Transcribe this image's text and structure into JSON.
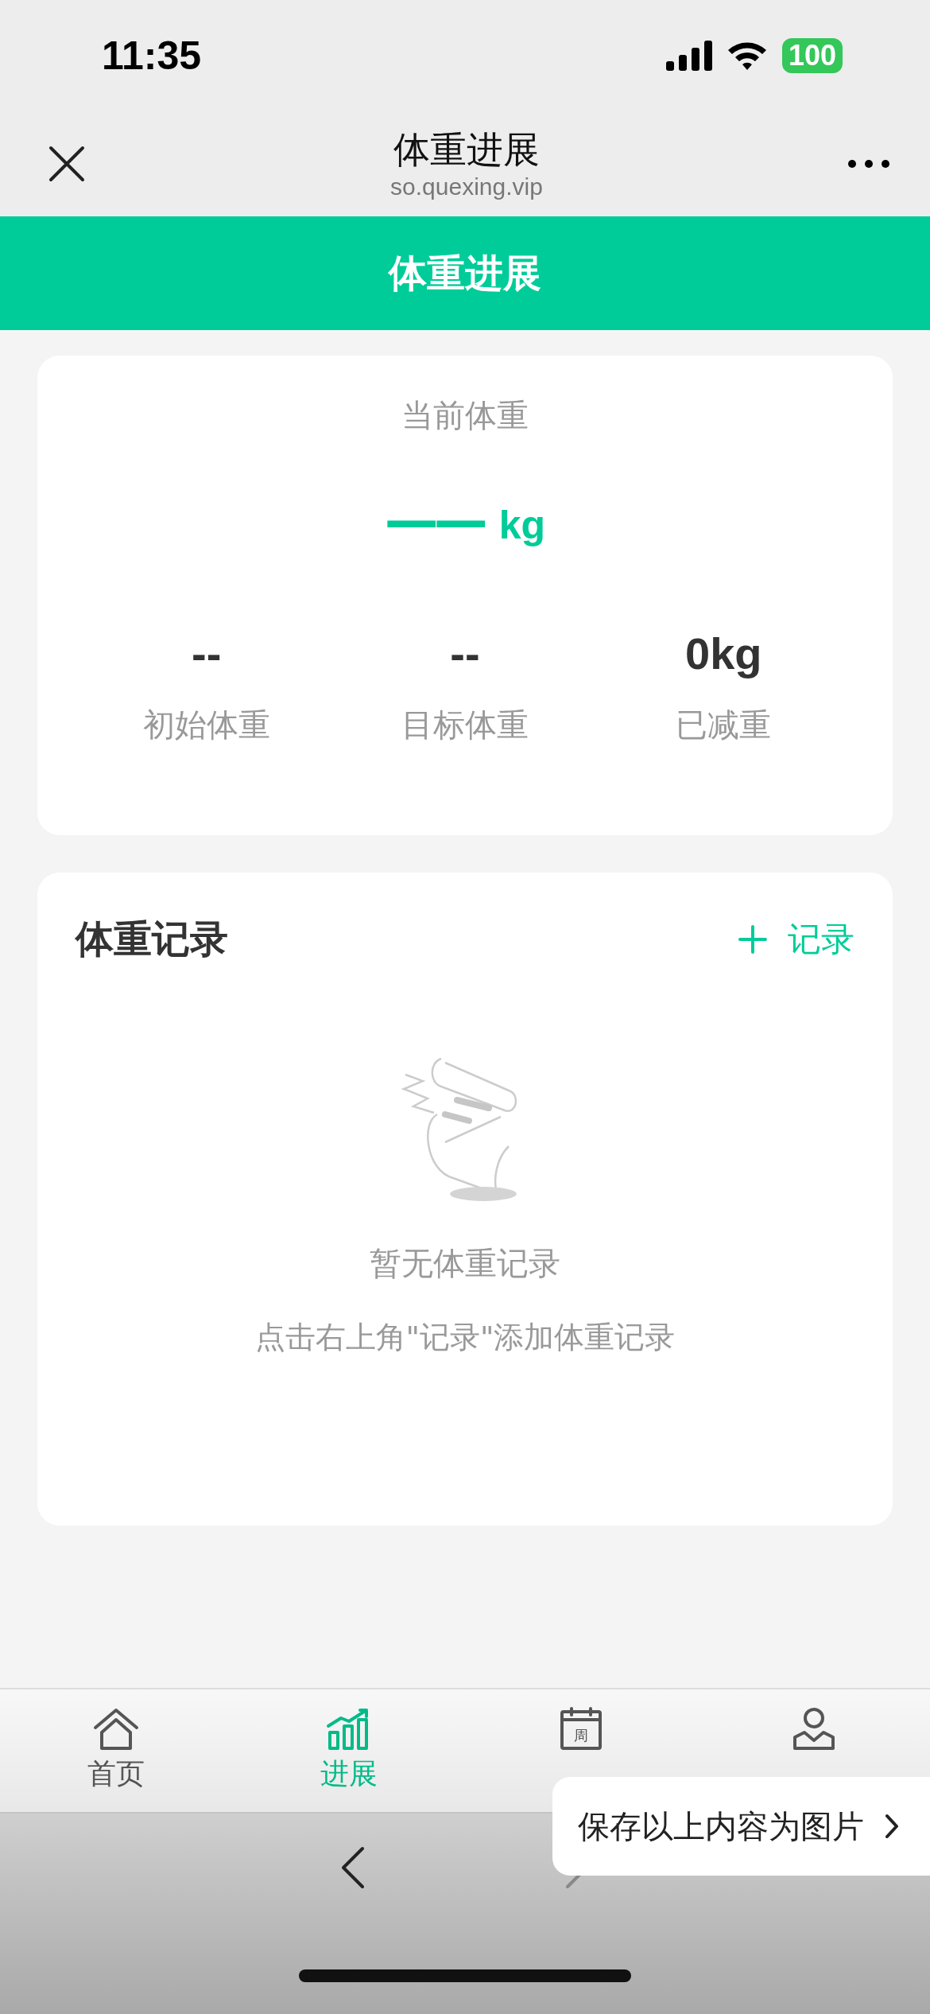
{
  "status_bar": {
    "time": "11:35",
    "battery": "100"
  },
  "nav_bar": {
    "title": "体重进展",
    "subtitle": "so.quexing.vip"
  },
  "banner": {
    "title": "体重进展"
  },
  "current_weight": {
    "label": "当前体重",
    "value": "——",
    "unit": "kg"
  },
  "stats": [
    {
      "value": "--",
      "label": "初始体重"
    },
    {
      "value": "--",
      "label": "目标体重"
    },
    {
      "value": "0kg",
      "label": "已减重"
    }
  ],
  "records": {
    "title": "体重记录",
    "add_button": "记录",
    "empty_title": "暂无体重记录",
    "empty_hint": "点击右上角\"记录\"添加体重记录"
  },
  "tabs": [
    {
      "label": "首页",
      "kind": "home",
      "selected": false
    },
    {
      "label": "进展",
      "kind": "chart",
      "selected": true
    },
    {
      "kind": "calendar",
      "icon_text": "周",
      "selected": false
    },
    {
      "kind": "user",
      "selected": false
    }
  ],
  "browser_bar": {
    "back_disabled": false,
    "forward_disabled": true
  },
  "popup": {
    "text": "保存以上内容为图片"
  }
}
